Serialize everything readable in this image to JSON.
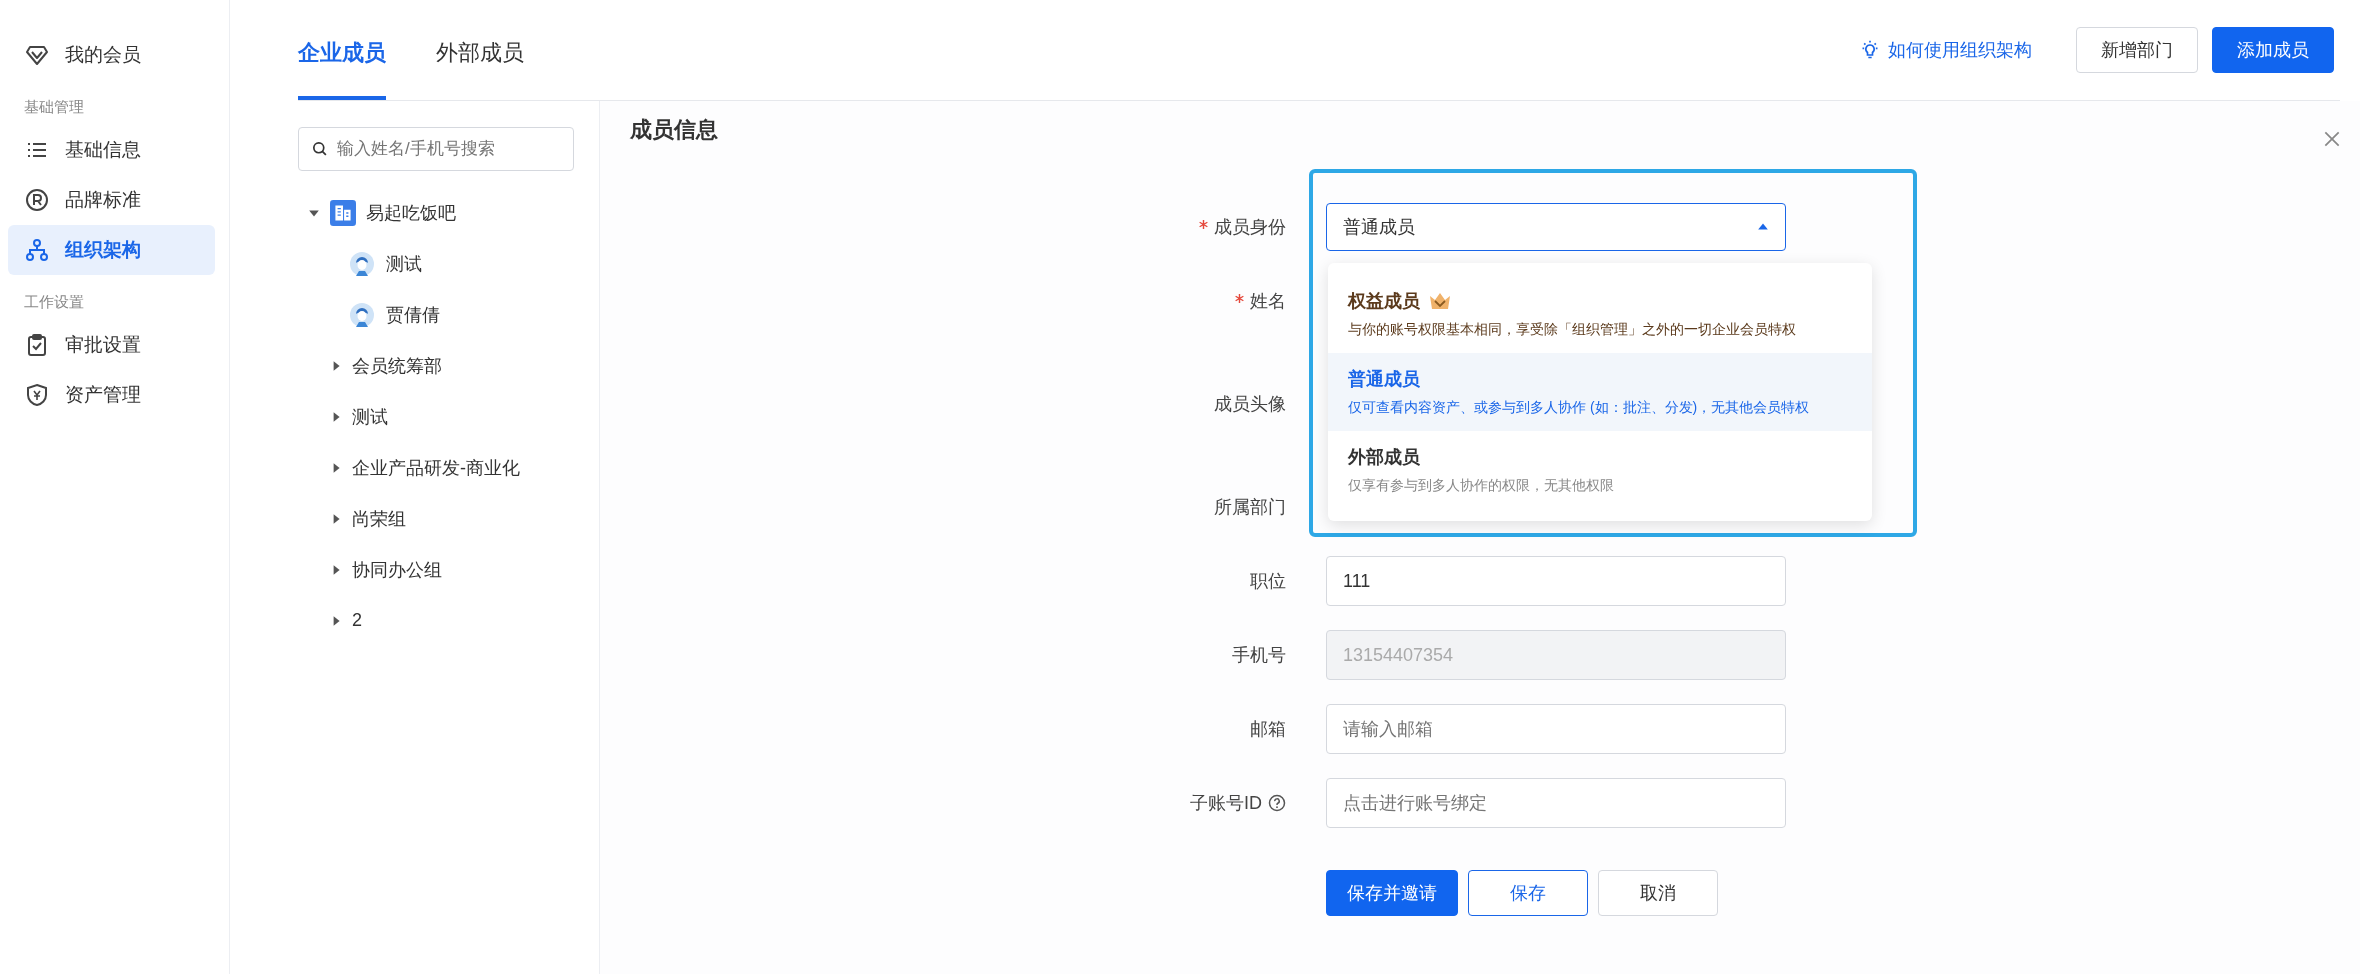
{
  "sidebar": {
    "top_item": {
      "label": "我的会员",
      "selected": false
    },
    "sections": [
      {
        "title": "基础管理",
        "items": [
          {
            "label": "基础信息",
            "selected": false
          },
          {
            "label": "品牌标准",
            "selected": false
          },
          {
            "label": "组织架构",
            "selected": true
          }
        ]
      },
      {
        "title": "工作设置",
        "items": [
          {
            "label": "审批设置",
            "selected": false
          },
          {
            "label": "资产管理",
            "selected": false
          }
        ]
      }
    ]
  },
  "tabs": [
    {
      "label": "企业成员",
      "selected": true
    },
    {
      "label": "外部成员",
      "selected": false
    }
  ],
  "header_actions": {
    "help_link": "如何使用组织架构",
    "buttons": [
      {
        "label": "新增部门",
        "kind": "default"
      },
      {
        "label": "添加成员",
        "kind": "primary"
      }
    ]
  },
  "tree": {
    "search": {
      "placeholder": "输入姓名/手机号搜索"
    },
    "root": {
      "label": "易起吃饭吧",
      "expanded": true,
      "children": [
        {
          "label": "测试",
          "kind": "member"
        },
        {
          "label": "贾倩倩",
          "kind": "member"
        },
        {
          "label": "会员统筹部",
          "kind": "department",
          "expanded": false
        },
        {
          "label": "测试",
          "kind": "department",
          "expanded": false
        },
        {
          "label": "企业产品研发-商业化",
          "kind": "department",
          "expanded": false
        },
        {
          "label": "尚荣组",
          "kind": "department",
          "expanded": false
        },
        {
          "label": "协同办公组",
          "kind": "department",
          "expanded": false
        },
        {
          "label": "2",
          "kind": "department",
          "expanded": false
        }
      ]
    }
  },
  "form": {
    "title": "成员信息",
    "fields": [
      {
        "label": "成员身份",
        "required": true,
        "kind": "select",
        "value": "普通成员",
        "expanded": true
      },
      {
        "label": "姓名",
        "required": true,
        "kind": "covered"
      },
      {
        "label": "成员头像",
        "required": false,
        "kind": "covered_tall"
      },
      {
        "label": "所属部门",
        "required": false,
        "kind": "covered"
      },
      {
        "label": "职位",
        "required": false,
        "kind": "text",
        "value": "111",
        "disabled": false
      },
      {
        "label": "手机号",
        "required": false,
        "kind": "text",
        "value": "13154407354",
        "disabled": true
      },
      {
        "label": "邮箱",
        "required": false,
        "kind": "text",
        "placeholder": "请输入邮箱",
        "disabled": false
      },
      {
        "label": "子账号ID",
        "required": false,
        "kind": "text",
        "placeholder": "点击进行账号绑定",
        "disabled": false,
        "help": true
      }
    ],
    "role_options": [
      {
        "title": "权益成员",
        "description": "与你的账号权限基本相同，享受除「组织管理」之外的一切企业会员特权",
        "kind": "premium",
        "selected": false
      },
      {
        "title": "普通成员",
        "description": "仅可查看内容资产、或参与到多人协作 (如：批注、分发)，无其他会员特权",
        "kind": "standard",
        "selected": true
      },
      {
        "title": "外部成员",
        "description": "仅享有参与到多人协作的权限，无其他权限",
        "kind": "standard",
        "selected": false
      }
    ],
    "buttons": [
      {
        "label": "保存并邀请",
        "kind": "primary"
      },
      {
        "label": "保存",
        "kind": "outline"
      },
      {
        "label": "取消",
        "kind": "default"
      }
    ]
  }
}
